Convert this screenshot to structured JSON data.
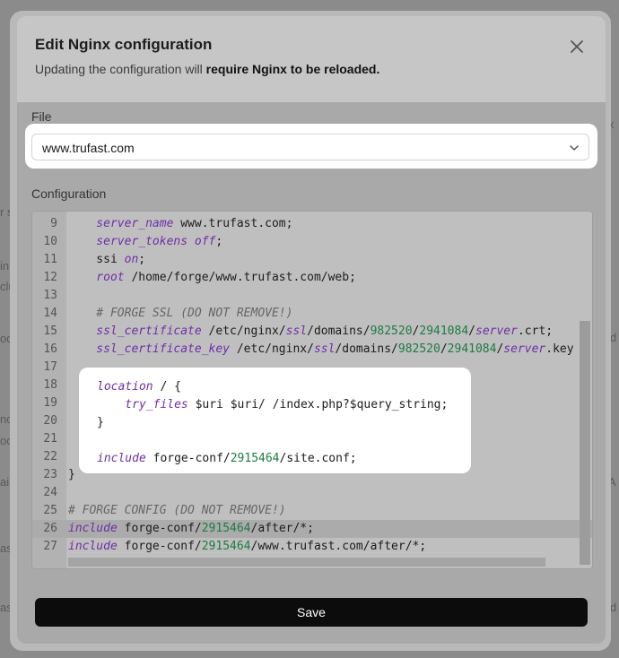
{
  "background": {
    "hints": [
      "x",
      "r s",
      "in",
      "clu",
      "od",
      "nc",
      "od",
      "ai",
      "as",
      "as",
      "d",
      "A",
      "d"
    ]
  },
  "modal": {
    "title": "Edit Nginx configuration",
    "subtitle_prefix": "Updating the configuration will ",
    "subtitle_strong": "require Nginx to be reloaded.",
    "file_label": "File",
    "file_value": "www.trufast.com",
    "config_label": "Configuration",
    "save_label": "Save"
  },
  "editor": {
    "lines": [
      {
        "n": "9",
        "code": [
          [
            "kw",
            "    server_name"
          ],
          [
            "t",
            " www.trufast.com;"
          ]
        ]
      },
      {
        "n": "10",
        "code": [
          [
            "kw",
            "    server_tokens"
          ],
          [
            "t",
            " "
          ],
          [
            "kw",
            "off"
          ],
          [
            "t",
            ";"
          ]
        ]
      },
      {
        "n": "11",
        "code": [
          [
            "t",
            "    ssi "
          ],
          [
            "kw",
            "on"
          ],
          [
            "t",
            ";"
          ]
        ]
      },
      {
        "n": "12",
        "code": [
          [
            "kw",
            "    root"
          ],
          [
            "t",
            " /home/forge/www.trufast.com/web;"
          ]
        ]
      },
      {
        "n": "13",
        "code": []
      },
      {
        "n": "14",
        "code": [
          [
            "cm",
            "    # FORGE SSL (DO NOT REMOVE!)"
          ]
        ]
      },
      {
        "n": "15",
        "code": [
          [
            "kw",
            "    ssl_certificate"
          ],
          [
            "t",
            " /etc/nginx/"
          ],
          [
            "kw",
            "ssl"
          ],
          [
            "t",
            "/domains/"
          ],
          [
            "num",
            "982520"
          ],
          [
            "t",
            "/"
          ],
          [
            "num",
            "2941084"
          ],
          [
            "t",
            "/"
          ],
          [
            "kw",
            "server"
          ],
          [
            "t",
            ".crt;"
          ]
        ]
      },
      {
        "n": "16",
        "code": [
          [
            "kw",
            "    ssl_certificate_key"
          ],
          [
            "t",
            " /etc/nginx/"
          ],
          [
            "kw",
            "ssl"
          ],
          [
            "t",
            "/domains/"
          ],
          [
            "num",
            "982520"
          ],
          [
            "t",
            "/"
          ],
          [
            "num",
            "2941084"
          ],
          [
            "t",
            "/"
          ],
          [
            "kw",
            "server"
          ],
          [
            "t",
            ".key"
          ]
        ]
      },
      {
        "n": "17",
        "code": []
      },
      {
        "n": "18",
        "code": [
          [
            "kw",
            "    location"
          ],
          [
            "t",
            " / {"
          ]
        ]
      },
      {
        "n": "19",
        "code": [
          [
            "kw",
            "        try_files"
          ],
          [
            "t",
            " $uri $uri/ /index.php?$query_string;"
          ]
        ]
      },
      {
        "n": "20",
        "code": [
          [
            "t",
            "    }"
          ]
        ]
      },
      {
        "n": "21",
        "code": []
      },
      {
        "n": "22",
        "code": [
          [
            "kw",
            "    include"
          ],
          [
            "t",
            " forge-conf/"
          ],
          [
            "num",
            "2915464"
          ],
          [
            "t",
            "/site.conf;"
          ]
        ]
      },
      {
        "n": "23",
        "code": [
          [
            "t",
            "}"
          ]
        ]
      },
      {
        "n": "24",
        "code": []
      },
      {
        "n": "25",
        "code": [
          [
            "cm",
            "# FORGE CONFIG (DO NOT REMOVE!)"
          ]
        ]
      },
      {
        "n": "26",
        "code": [
          [
            "kw",
            "include"
          ],
          [
            "t",
            " forge-conf/"
          ],
          [
            "num",
            "2915464"
          ],
          [
            "t",
            "/after/*;"
          ]
        ],
        "active": true
      },
      {
        "n": "27",
        "code": [
          [
            "kw",
            "include"
          ],
          [
            "t",
            " forge-conf/"
          ],
          [
            "num",
            "2915464"
          ],
          [
            "t",
            "/www.trufast.com/after/*;"
          ]
        ]
      }
    ],
    "highlight_lines": [
      [
        [
          "kw",
          "location"
        ],
        [
          "t",
          " / {"
        ]
      ],
      [
        [
          "kw",
          "    try_files"
        ],
        [
          "t",
          " $uri $uri/ /index.php?$query_string;"
        ]
      ],
      [
        [
          "t",
          "}"
        ]
      ],
      [],
      [
        [
          "kw",
          "include"
        ],
        [
          "t",
          " forge-conf/"
        ],
        [
          "num",
          "2915464"
        ],
        [
          "t",
          "/site.conf;"
        ]
      ]
    ]
  },
  "icons": {
    "close": "close-icon",
    "chevron": "chevron-down-icon"
  }
}
